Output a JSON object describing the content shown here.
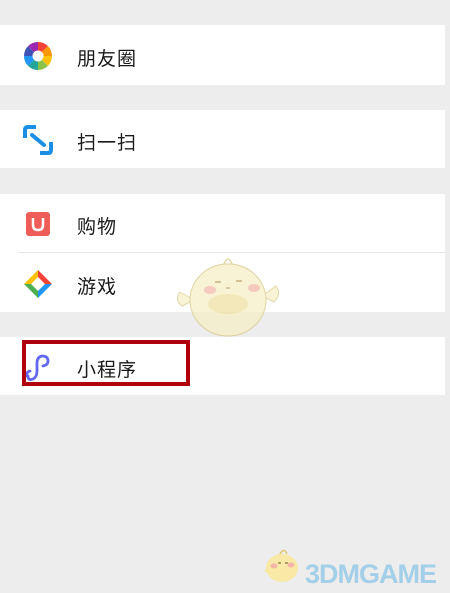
{
  "menu": {
    "moments": {
      "label": "朋友圈",
      "icon": "moments-aperture-icon"
    },
    "scan": {
      "label": "扫一扫",
      "icon": "scan-icon"
    },
    "shopping": {
      "label": "购物",
      "icon": "shopping-bag-icon"
    },
    "games": {
      "label": "游戏",
      "icon": "games-diamond-icon"
    },
    "mini_programs": {
      "label": "小程序",
      "icon": "mini-program-icon",
      "highlighted": true
    }
  },
  "colors": {
    "background": "#ededed",
    "row_background": "#ffffff",
    "highlight_border": "#b0000e",
    "scan_icon": "#1b8fe6",
    "shopping_icon": "#f05d58",
    "mini_program_icon": "#6468f0"
  },
  "watermark": {
    "text": "3DMGAME",
    "icon": "chick-mascot-icon"
  }
}
